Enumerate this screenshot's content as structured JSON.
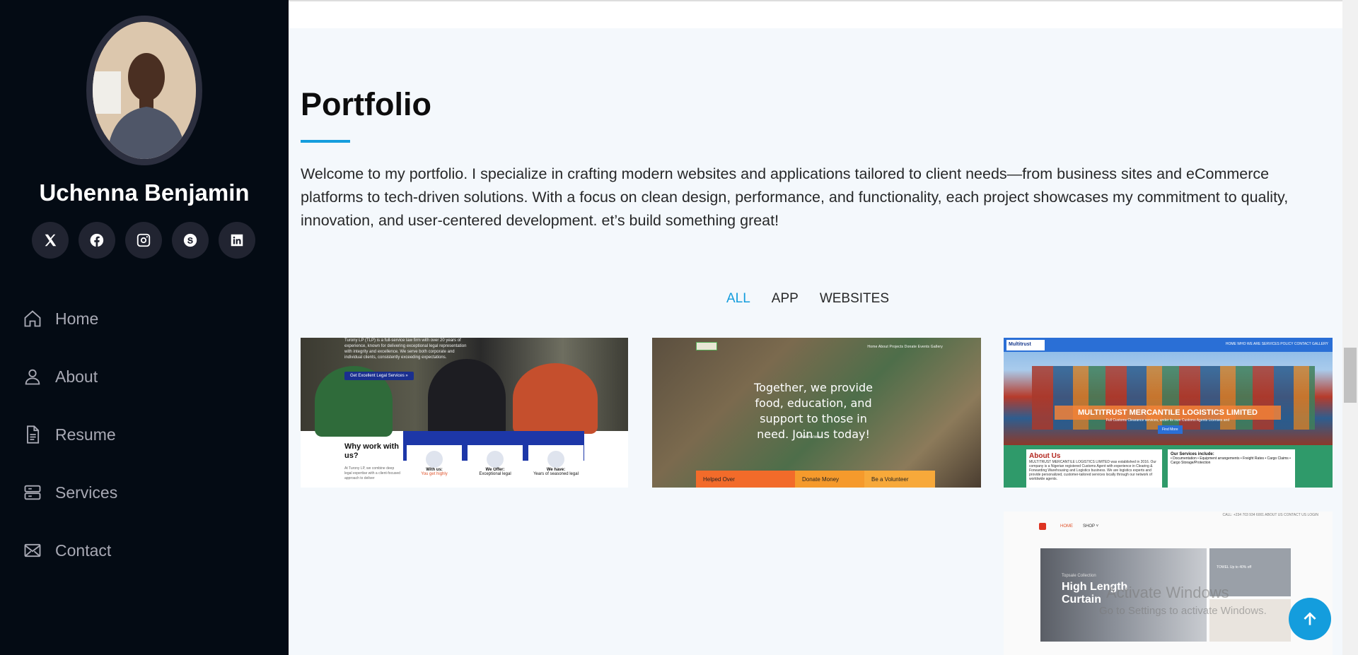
{
  "profile": {
    "name": "Uchenna Benjamin"
  },
  "socials": [
    {
      "icon": "x-icon"
    },
    {
      "icon": "facebook-icon"
    },
    {
      "icon": "instagram-icon"
    },
    {
      "icon": "skype-icon"
    },
    {
      "icon": "linkedin-icon"
    }
  ],
  "nav": {
    "items": [
      {
        "label": "Home",
        "icon": "house-icon"
      },
      {
        "label": "About",
        "icon": "person-icon"
      },
      {
        "label": "Resume",
        "icon": "file-icon"
      },
      {
        "label": "Services",
        "icon": "server-icon"
      },
      {
        "label": "Contact",
        "icon": "envelope-icon"
      }
    ]
  },
  "portfolio": {
    "title": "Portfolio",
    "intro": "Welcome to my portfolio. I specialize in crafting modern websites and applications tailored to client needs—from business sites and eCommerce platforms to tech-driven solutions. With a focus on clean design, performance, and functionality, each project showcases my commitment to quality, innovation, and user-centered development. et’s build something great!",
    "filters": [
      "ALL",
      "APP",
      "WEBSITES"
    ]
  },
  "cards": {
    "legal": {
      "text": "Turony LP (TLP) is a full-service law firm with over 20 years of experience, known for delivering exceptional legal representation with integrity and excellence. We serve both corporate and individual clients, consistently exceeding expectations.",
      "button": "Get Excellent Legal Services »",
      "heading": "Why work with us?",
      "sub": "At Turony LP, we combine deep legal expertise with a client-focused approach to deliver",
      "mini": [
        {
          "title": "With us:",
          "sub": "You get highly"
        },
        {
          "title": "We Offer:",
          "sub": "Exceptional legal"
        },
        {
          "title": "We have:",
          "sub": "Years of seasoned legal"
        }
      ]
    },
    "charity": {
      "nav": "Home   About   Projects   Donate   Events   Gallery",
      "headline": "Together, we provide food, education, and support to those in need. Join us today!",
      "watch": "Watch Video",
      "bars": [
        "Helped Over",
        "Donate Money",
        "Be a Volunteer"
      ]
    },
    "logistics": {
      "logo": "Multitrust",
      "nav": "HOME   WHO WE ARE   SERVICES   POLICY   CONTACT   GALLERY",
      "banner": "MULTITRUST MERCANTILE LOGISTICS LIMITED",
      "banner_sub": "Full Customs Clearance services, under its own Customs Agents Licenses and",
      "find": "Find More",
      "about_title": "About Us",
      "about_text": "MULTITRUST MERCANTILE LOGISTICS LIMITED was established in 2016. Our company is a Nigerian registered Customs Agent with experience in Clearing & Forwarding Warehousing and Logistics business. We are logistics experts and provide personalized, customer-tailored services locally through our network of worldwide agents.",
      "services_title": "Our Services include:",
      "services": "• Documentation  • Equipment arrangements  • Freight Rates  • Cargo Claims  • Cargo Storage/Protection"
    },
    "shop": {
      "utility": "CALL: +234 703 934 6001    ABOUT US    CONTACT US    LOGIN",
      "home": "HOME",
      "shop": "SHOP ˅",
      "kicker": "Topsale Collection",
      "hero": "High Length Curtain",
      "side": "TOWEL Up to 40% off"
    }
  },
  "watermark": {
    "title": "Activate Windows",
    "sub": "Go to Settings to activate Windows."
  }
}
